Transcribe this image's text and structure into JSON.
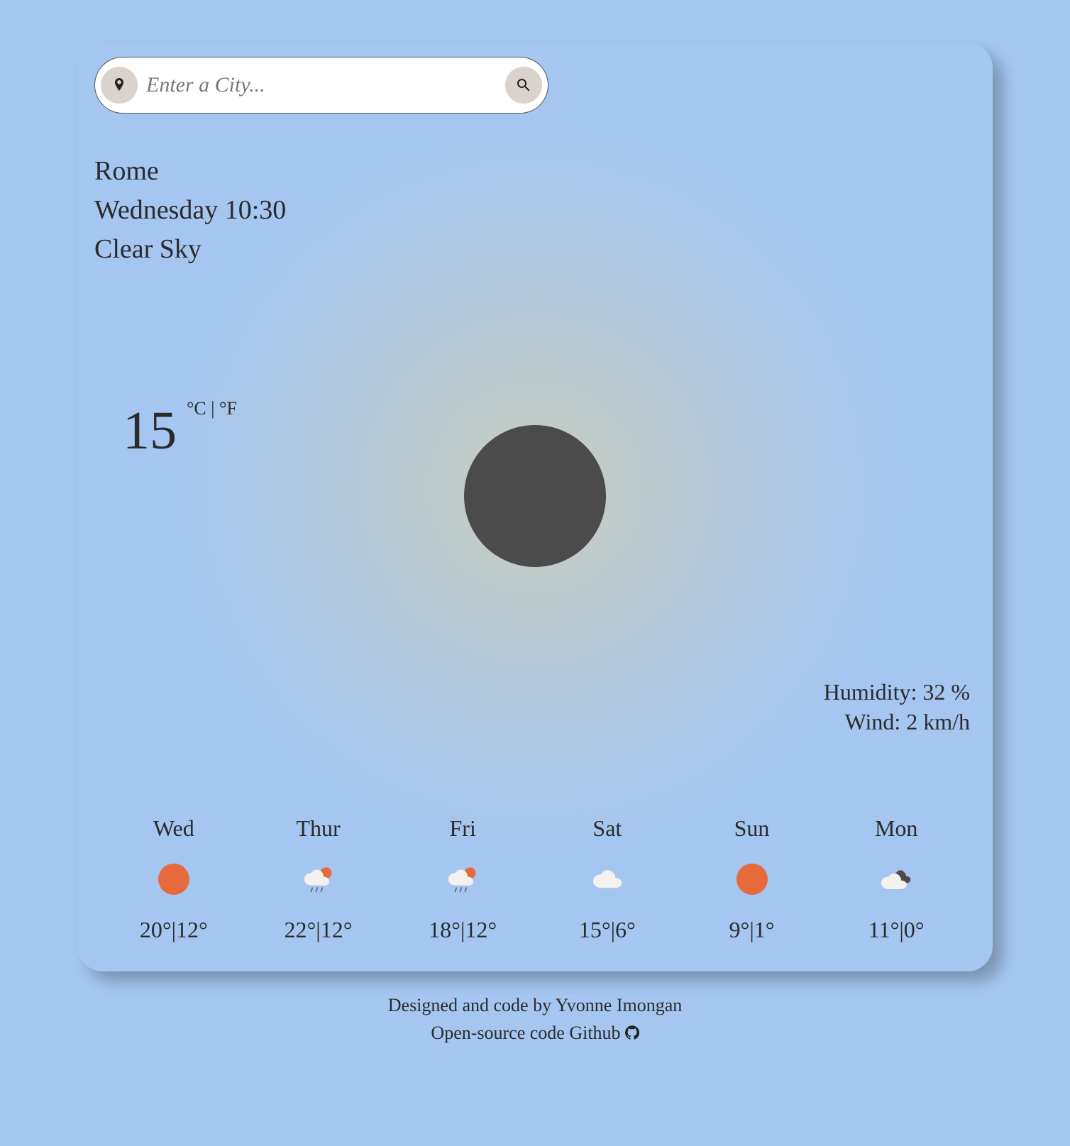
{
  "search": {
    "placeholder": "Enter a City..."
  },
  "header": {
    "city": "Rome",
    "datetime": "Wednesday 10:30",
    "condition": "Clear Sky"
  },
  "current": {
    "temp": "15",
    "units_label": "°C | °F",
    "humidity_label": "Humidity: 32 %",
    "wind_label": "Wind: 2 km/h"
  },
  "forecast": [
    {
      "day": "Wed",
      "icon": "sun",
      "range": "20°|12°"
    },
    {
      "day": "Thur",
      "icon": "rain-sun",
      "range": "22°|12°"
    },
    {
      "day": "Fri",
      "icon": "rain-sun",
      "range": "18°|12°"
    },
    {
      "day": "Sat",
      "icon": "cloud",
      "range": "15°|6°"
    },
    {
      "day": "Sun",
      "icon": "sun",
      "range": "9°|1°"
    },
    {
      "day": "Mon",
      "icon": "cloud-dark",
      "range": "11°|0°"
    }
  ],
  "footer": {
    "credit": "Designed and code by Yvonne Imongan",
    "source": "Open-source code Github"
  }
}
